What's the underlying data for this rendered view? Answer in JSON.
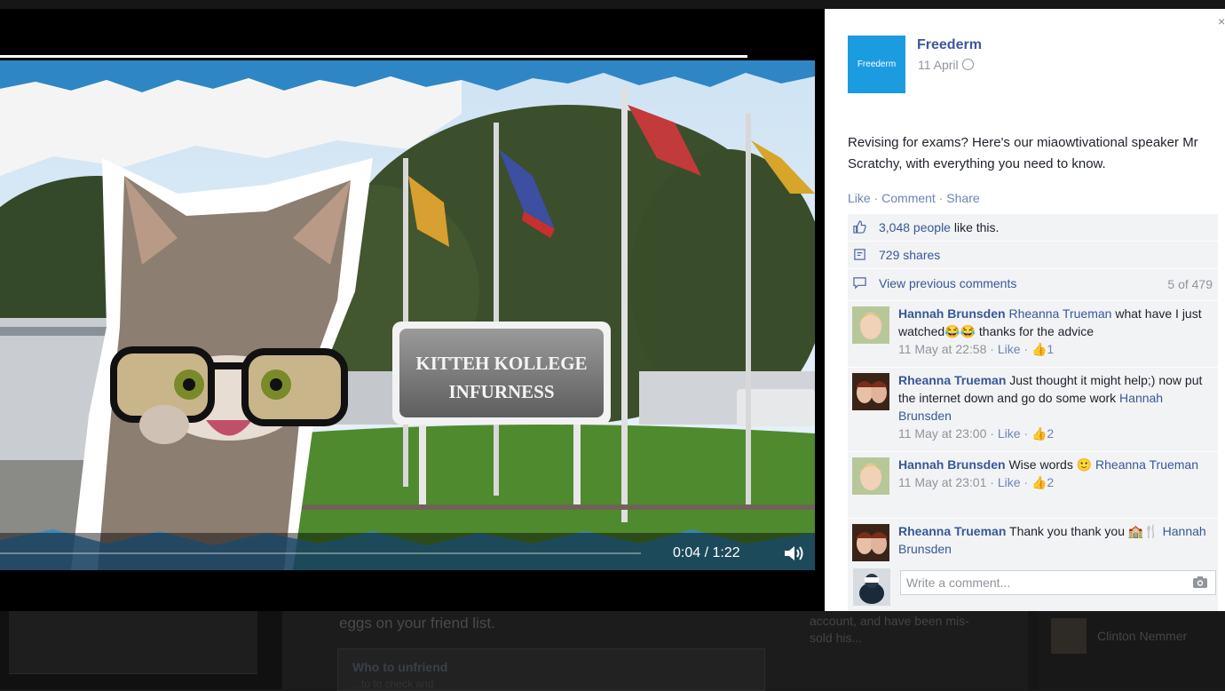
{
  "background": {
    "main_text": "eggs on your friend list.",
    "who_to_unfriend": "Who to unfriend",
    "who_sub": "...to to check and",
    "right_text": "account, and have been mis-sold his...",
    "far_name": "Clinton Nemmer"
  },
  "video": {
    "sign_line1": "KITTEH KOLLEGE",
    "sign_line2": "INFURNESS",
    "time": "0:04 / 1:22",
    "progress": 0.05
  },
  "post": {
    "page_name": "Freederm",
    "logo_text": "Freederm",
    "date": "11 April",
    "text": "Revising for exams? Here's our miaowtivational speaker Mr Scratchy, with everything you need to know.",
    "like": "Like",
    "comment": "Comment",
    "share": "Share",
    "likes_count": "3,048 people",
    "likes_suffix": " like this.",
    "shares": "729 shares",
    "view_previous": "View previous comments",
    "comment_count": "5 of 479"
  },
  "comments": [
    {
      "name": "Hannah Brunsden",
      "tag": "Rheanna Trueman",
      "text": " what have I just watched😂😂 thanks for the advice",
      "time": "11 May at 22:58",
      "like": "Like",
      "likes": "1"
    },
    {
      "name": "Rheanna Trueman",
      "tag": "",
      "text": " Just thought it might help;) now put the internet down and go do some work ",
      "tag2": "Hannah Brunsden",
      "time": "11 May at 23:00",
      "like": "Like",
      "likes": "2"
    },
    {
      "name": "Hannah Brunsden",
      "tag": "",
      "text": " Wise words 🙂 ",
      "tag2": "Rheanna Trueman",
      "time": "11 May at 23:01",
      "like": "Like",
      "likes": "2"
    },
    {
      "name": "Rheanna Trueman",
      "tag": "",
      "text": " Thank you thank you 🏫🍴 ",
      "tag2": "Hannah Brunsden",
      "time": "",
      "like": "",
      "likes": ""
    }
  ],
  "composer": {
    "placeholder": "Write a comment..."
  },
  "close": "×",
  "colors": {
    "brand": "#1c9ce0",
    "link": "#365899"
  }
}
